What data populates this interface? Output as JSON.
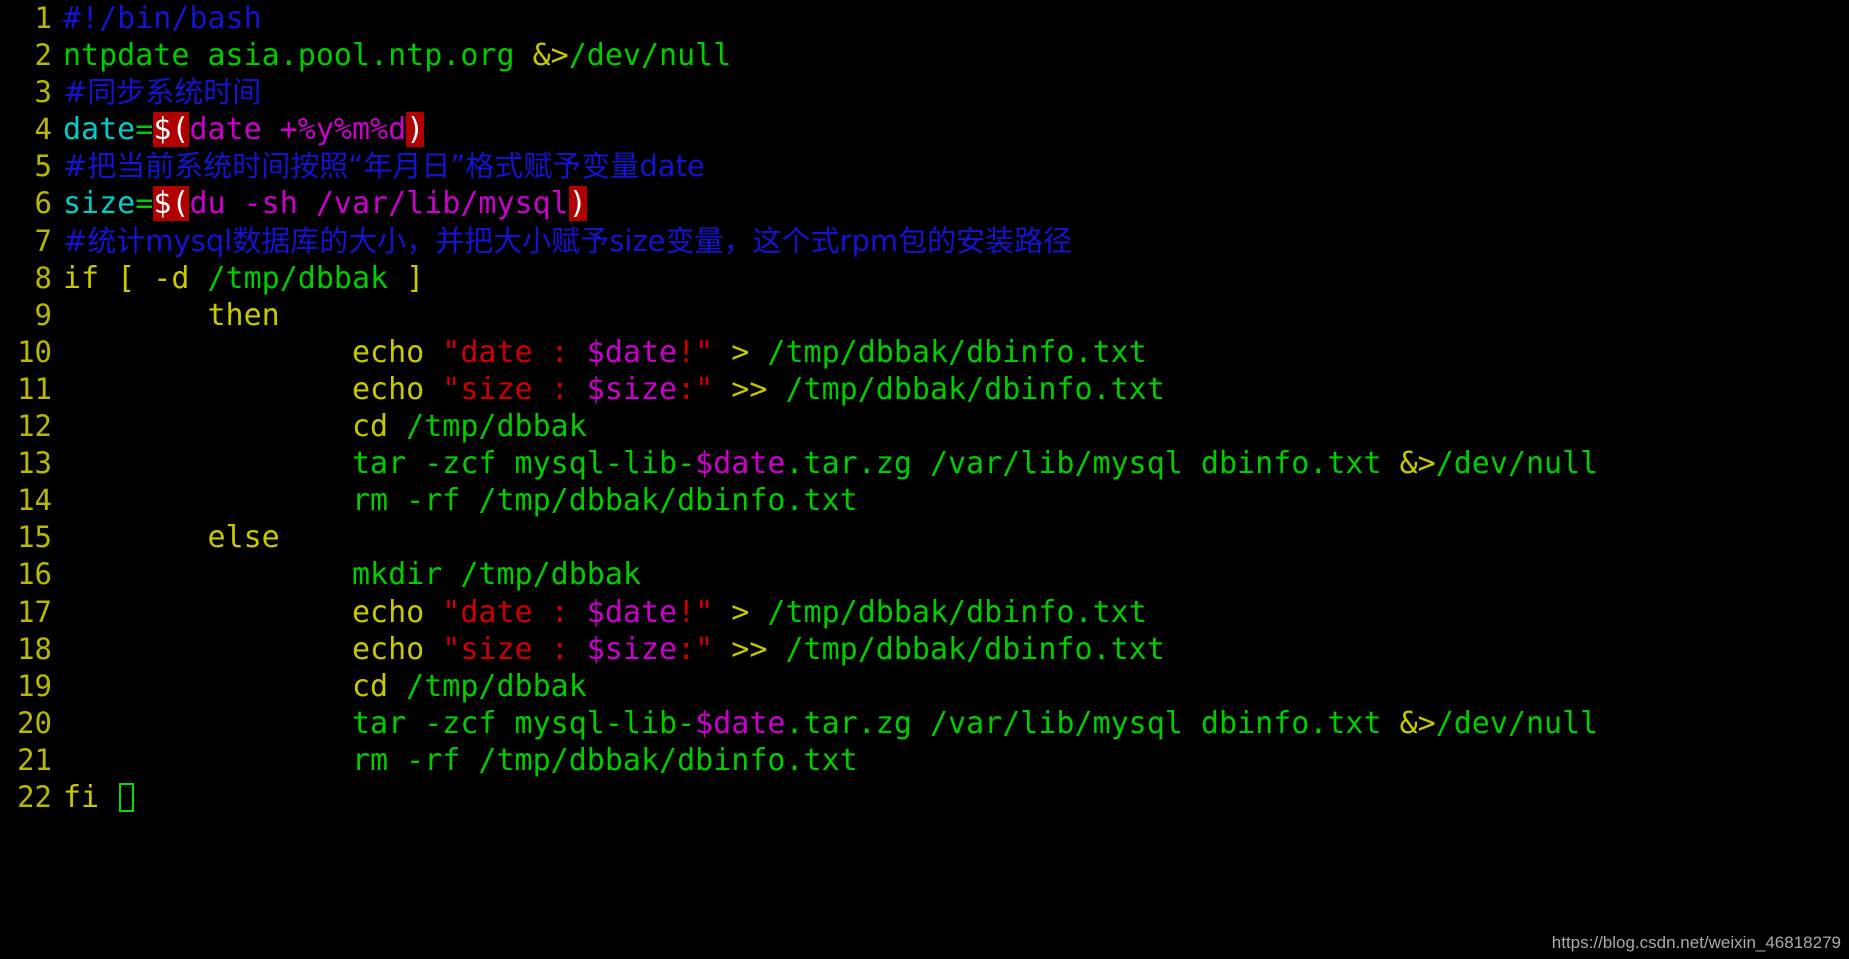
{
  "editor": {
    "type": "terminal-text-editor",
    "background_color": "#000000",
    "cursor": {
      "line": 22,
      "column": 4,
      "style": "hollow-block",
      "color": "#00dd00"
    },
    "palette": {
      "line_number": "#b8b800",
      "comment": "#1414d0",
      "string": "#cc0000",
      "keyword": "#c8c800",
      "command": "#00cc00",
      "variable": "#cc00cc",
      "identifier": "#00cccc",
      "command_substitution_bg": "#b00000",
      "command_substitution_fg": "#ffffff"
    },
    "total_lines": 22,
    "lines": [
      {
        "n": "1",
        "tokens": [
          {
            "text": "#!/bin/bash",
            "color": "blue"
          }
        ]
      },
      {
        "n": "2",
        "tokens": [
          {
            "text": "ntpdate asia.pool.ntp.org ",
            "color": "green"
          },
          {
            "text": "&>",
            "color": "yellow"
          },
          {
            "text": "/dev/null",
            "color": "green"
          }
        ]
      },
      {
        "n": "3",
        "tokens": [
          {
            "text": "#同步系统时间",
            "color": "blue",
            "cjk": true
          }
        ]
      },
      {
        "n": "4",
        "tokens": [
          {
            "text": "date",
            "color": "cyan"
          },
          {
            "text": "=",
            "color": "green"
          },
          {
            "text": "$(",
            "color": "subst"
          },
          {
            "text": "date +%y%m%d",
            "color": "magenta"
          },
          {
            "text": ")",
            "color": "subst"
          }
        ]
      },
      {
        "n": "5",
        "tokens": [
          {
            "text": "#把当前系统时间按照“年月日”格式赋予变量date",
            "color": "blue",
            "cjk": true
          }
        ]
      },
      {
        "n": "6",
        "tokens": [
          {
            "text": "size",
            "color": "cyan"
          },
          {
            "text": "=",
            "color": "green"
          },
          {
            "text": "$(",
            "color": "subst"
          },
          {
            "text": "du -sh /var/lib/mysql",
            "color": "magenta"
          },
          {
            "text": ")",
            "color": "subst"
          }
        ]
      },
      {
        "n": "7",
        "tokens": [
          {
            "text": "#统计mysql数据库的大小，并把大小赋予size变量，这个式rpm包的安装路径",
            "color": "blue",
            "cjk": true
          }
        ]
      },
      {
        "n": "8",
        "tokens": [
          {
            "text": "if [ -d ",
            "color": "yellow"
          },
          {
            "text": "/tmp/dbbak",
            "color": "green"
          },
          {
            "text": " ]",
            "color": "yellow"
          }
        ]
      },
      {
        "n": "9",
        "tokens": [
          {
            "text": "        then",
            "color": "yellow"
          }
        ]
      },
      {
        "n": "10",
        "tokens": [
          {
            "text": "                echo ",
            "color": "yellow"
          },
          {
            "text": "\"date : ",
            "color": "red"
          },
          {
            "text": "$date",
            "color": "magenta"
          },
          {
            "text": "!\"",
            "color": "red"
          },
          {
            "text": " > ",
            "color": "yellow"
          },
          {
            "text": "/tmp/dbbak/dbinfo.txt",
            "color": "green"
          }
        ]
      },
      {
        "n": "11",
        "tokens": [
          {
            "text": "                echo ",
            "color": "yellow"
          },
          {
            "text": "\"size : ",
            "color": "red"
          },
          {
            "text": "$size",
            "color": "magenta"
          },
          {
            "text": ":\"",
            "color": "red"
          },
          {
            "text": " >> ",
            "color": "yellow"
          },
          {
            "text": "/tmp/dbbak/dbinfo.txt",
            "color": "green"
          }
        ]
      },
      {
        "n": "12",
        "tokens": [
          {
            "text": "                cd ",
            "color": "yellow"
          },
          {
            "text": "/tmp/dbbak",
            "color": "green"
          }
        ]
      },
      {
        "n": "13",
        "tokens": [
          {
            "text": "                ",
            "color": "green"
          },
          {
            "text": "tar -zcf mysql-lib-",
            "color": "green"
          },
          {
            "text": "$date",
            "color": "magenta"
          },
          {
            "text": ".tar.zg /var/lib/mysql dbinfo.txt ",
            "color": "green"
          },
          {
            "text": "&>",
            "color": "yellow"
          },
          {
            "text": "/dev/null",
            "color": "green"
          }
        ]
      },
      {
        "n": "14",
        "tokens": [
          {
            "text": "                rm -rf /tmp/dbbak/dbinfo.txt",
            "color": "green"
          }
        ]
      },
      {
        "n": "15",
        "tokens": [
          {
            "text": "        else",
            "color": "yellow"
          }
        ]
      },
      {
        "n": "16",
        "tokens": [
          {
            "text": "                mkdir /tmp/dbbak",
            "color": "green"
          }
        ]
      },
      {
        "n": "17",
        "tokens": [
          {
            "text": "                echo ",
            "color": "yellow"
          },
          {
            "text": "\"date : ",
            "color": "red"
          },
          {
            "text": "$date",
            "color": "magenta"
          },
          {
            "text": "!\"",
            "color": "red"
          },
          {
            "text": " > ",
            "color": "yellow"
          },
          {
            "text": "/tmp/dbbak/dbinfo.txt",
            "color": "green"
          }
        ]
      },
      {
        "n": "18",
        "tokens": [
          {
            "text": "                echo ",
            "color": "yellow"
          },
          {
            "text": "\"size : ",
            "color": "red"
          },
          {
            "text": "$size",
            "color": "magenta"
          },
          {
            "text": ":\"",
            "color": "red"
          },
          {
            "text": " >> ",
            "color": "yellow"
          },
          {
            "text": "/tmp/dbbak/dbinfo.txt",
            "color": "green"
          }
        ]
      },
      {
        "n": "19",
        "tokens": [
          {
            "text": "                cd ",
            "color": "yellow"
          },
          {
            "text": "/tmp/dbbak",
            "color": "green"
          }
        ]
      },
      {
        "n": "20",
        "tokens": [
          {
            "text": "                tar -zcf mysql-lib-",
            "color": "green"
          },
          {
            "text": "$date",
            "color": "magenta"
          },
          {
            "text": ".tar.zg /var/lib/mysql dbinfo.txt ",
            "color": "green"
          },
          {
            "text": "&>",
            "color": "yellow"
          },
          {
            "text": "/dev/null",
            "color": "green"
          }
        ]
      },
      {
        "n": "21",
        "tokens": [
          {
            "text": "                rm -rf /tmp/dbbak/dbinfo.txt",
            "color": "green"
          }
        ]
      },
      {
        "n": "22",
        "tokens": [
          {
            "text": "fi ",
            "color": "yellow"
          }
        ],
        "cursor": true
      }
    ]
  },
  "watermark": {
    "text": "https://blog.csdn.net/weixin_46818279",
    "color": "#b9b9b9"
  }
}
